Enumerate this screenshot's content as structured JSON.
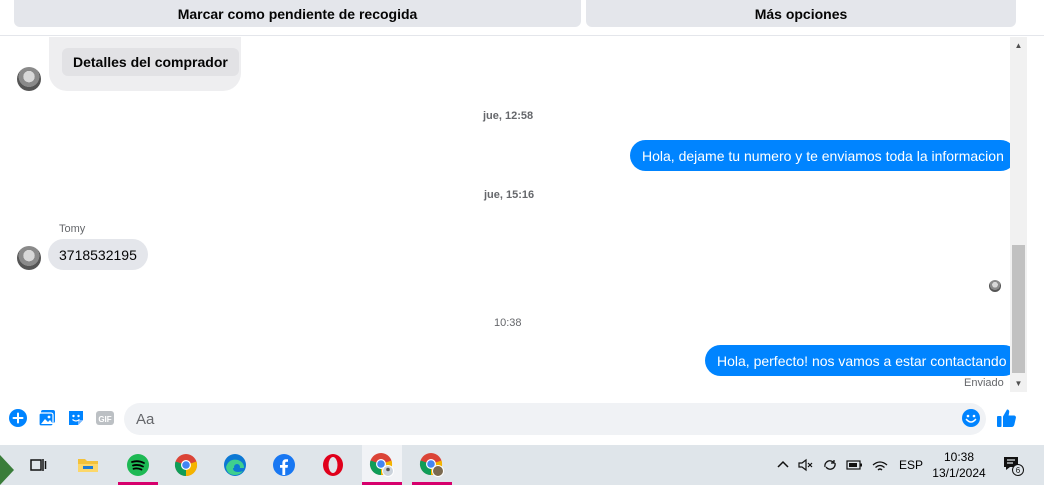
{
  "topbar": {
    "mark_pending_label": "Marcar como pendiente de recogida",
    "more_options_label": "Más opciones"
  },
  "chat": {
    "buyer_details_label": "Detalles del comprador",
    "timestamps": [
      "jue, 12:58",
      "jue, 15:16",
      "10:38"
    ],
    "messages": [
      {
        "from": "me",
        "text": "Hola, dejame tu numero y te enviamos toda la informacion"
      },
      {
        "from": "Tomy",
        "sender_label": "Tomy",
        "text": "3718532195"
      },
      {
        "from": "me",
        "text": "Hola, perfecto! nos vamos a estar contactando"
      }
    ],
    "status": "Enviado"
  },
  "composer": {
    "placeholder": "Aa",
    "icons": [
      "plus-icon",
      "photo-icon",
      "sticker-icon",
      "gif-icon",
      "emoji-icon",
      "like-icon"
    ],
    "gif_label": "GIF"
  },
  "taskbar": {
    "apps": [
      "task-view",
      "file-explorer",
      "spotify",
      "chrome",
      "edge",
      "facebook",
      "opera",
      "chrome-profile-1",
      "chrome-profile-2"
    ],
    "tray": {
      "language": "ESP",
      "time": "10:38",
      "date": "13/1/2024",
      "notification_count": "6"
    }
  },
  "colors": {
    "messenger_blue": "#0084ff",
    "incoming_bubble": "#e4e6eb",
    "taskbar": "#dfe5ea",
    "active_indicator": "#d6006c"
  }
}
